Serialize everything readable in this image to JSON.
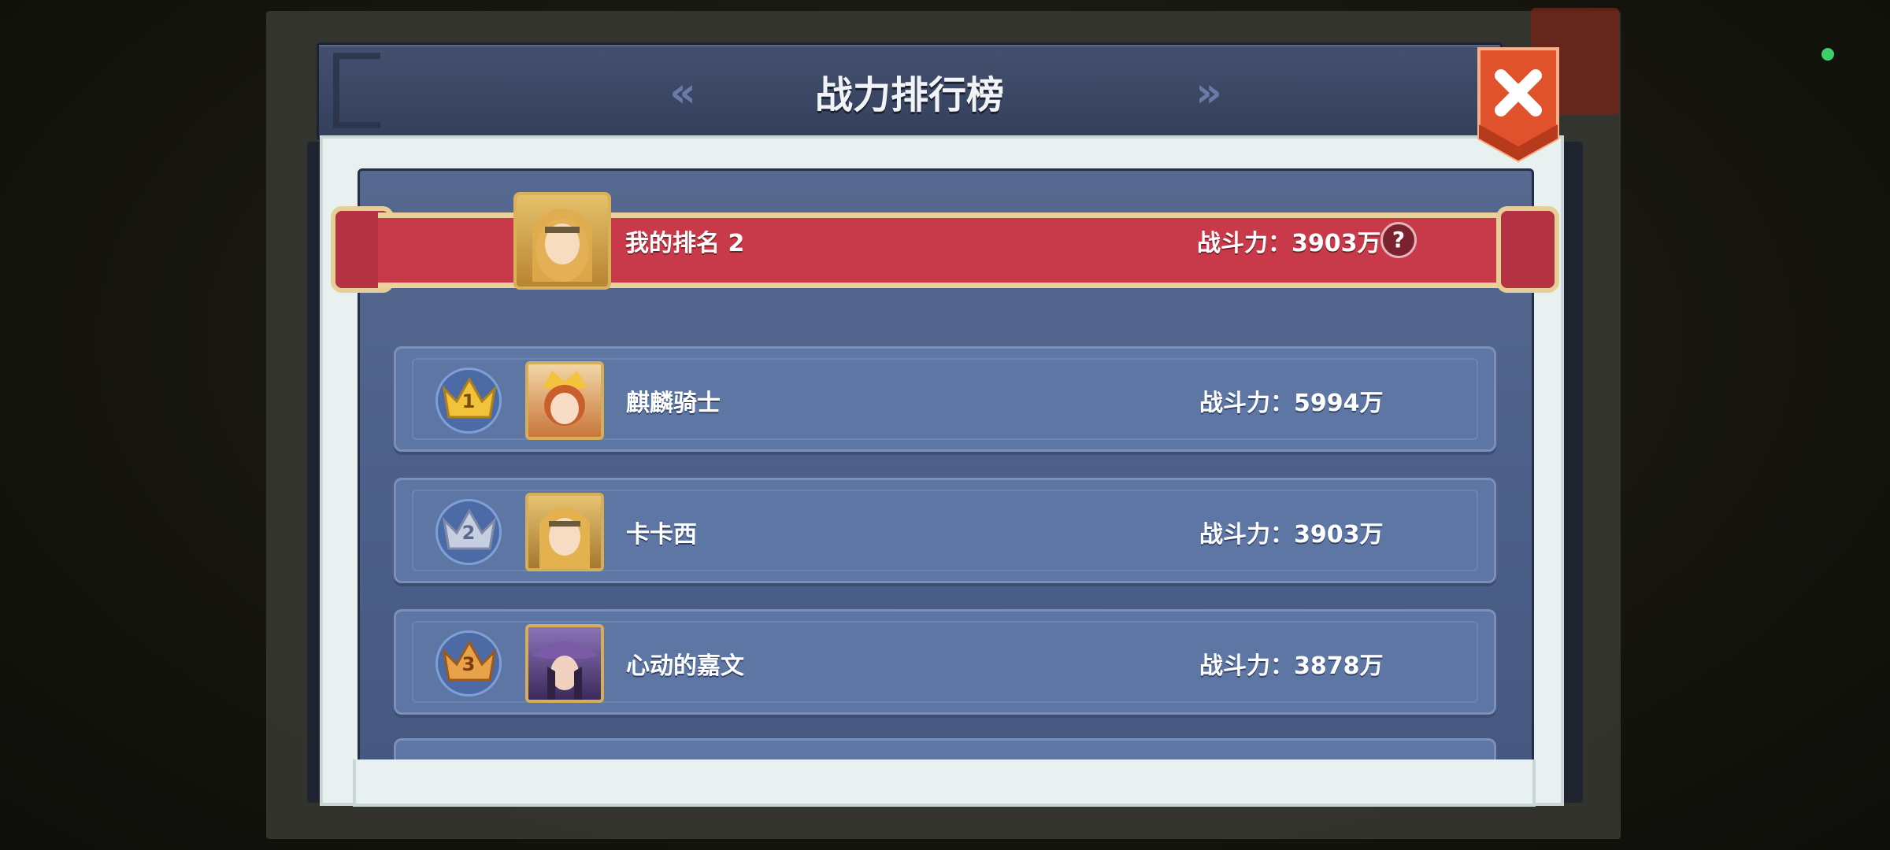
{
  "title": "战力排行榜",
  "nav": {
    "prev_icon": "double-chevron-left-icon",
    "next_icon": "double-chevron-right-icon"
  },
  "close_icon": "close-icon",
  "my_rank": {
    "label": "我的排名   2",
    "power": "战斗力：3903万",
    "help": "?"
  },
  "rows": [
    {
      "rank": "1",
      "name": "麒麟骑士",
      "power": "战斗力：5994万",
      "crown_color": "#f2c23a"
    },
    {
      "rank": "2",
      "name": "卡卡西",
      "power": "战斗力：3903万",
      "crown_color": "#c6cfe2"
    },
    {
      "rank": "3",
      "name": "心动的嘉文",
      "power": "战斗力：3878万",
      "crown_color": "#e8a24a"
    }
  ],
  "colors": {
    "ribbon": "#c8394a",
    "panel": "#4c5f88",
    "close": "#d9502e"
  }
}
